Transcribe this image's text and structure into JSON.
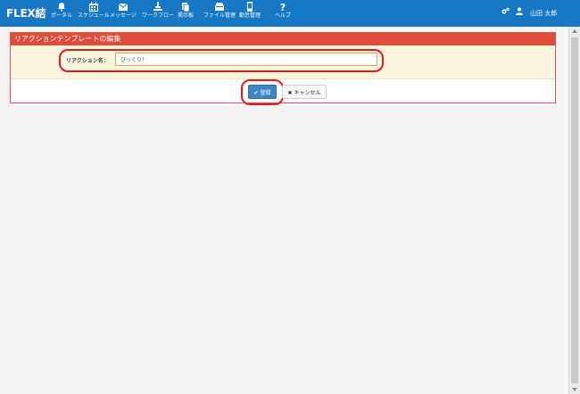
{
  "nav": {
    "brand": "FLEX結",
    "items": [
      {
        "label": "ポータル",
        "icon": "bell-icon"
      },
      {
        "label": "スケジュール",
        "icon": "calendar-icon"
      },
      {
        "label": "メッセージ",
        "icon": "envelope-icon"
      },
      {
        "label": "ワークフロー",
        "icon": "workflow-icon"
      },
      {
        "label": "掲示板",
        "icon": "board-icon"
      },
      {
        "label": "ファイル管理",
        "icon": "file-icon"
      },
      {
        "label": "勤怠管理",
        "icon": "attendance-icon"
      },
      {
        "label": "ヘルプ",
        "icon": "help-icon"
      }
    ],
    "user_name": "山田 太郎"
  },
  "panel": {
    "title": "リアクションテンプレートの編集",
    "field_label": "リアクション名：",
    "field_value": "びっくり！",
    "save_label": "登録",
    "cancel_label": "キャンセル"
  },
  "colors": {
    "navbar": "#1677c4",
    "panel_heading": "#df4d3a",
    "form_row": "#fcf6df",
    "primary_button": "#3c86c4",
    "highlight": "#e21b1b"
  }
}
